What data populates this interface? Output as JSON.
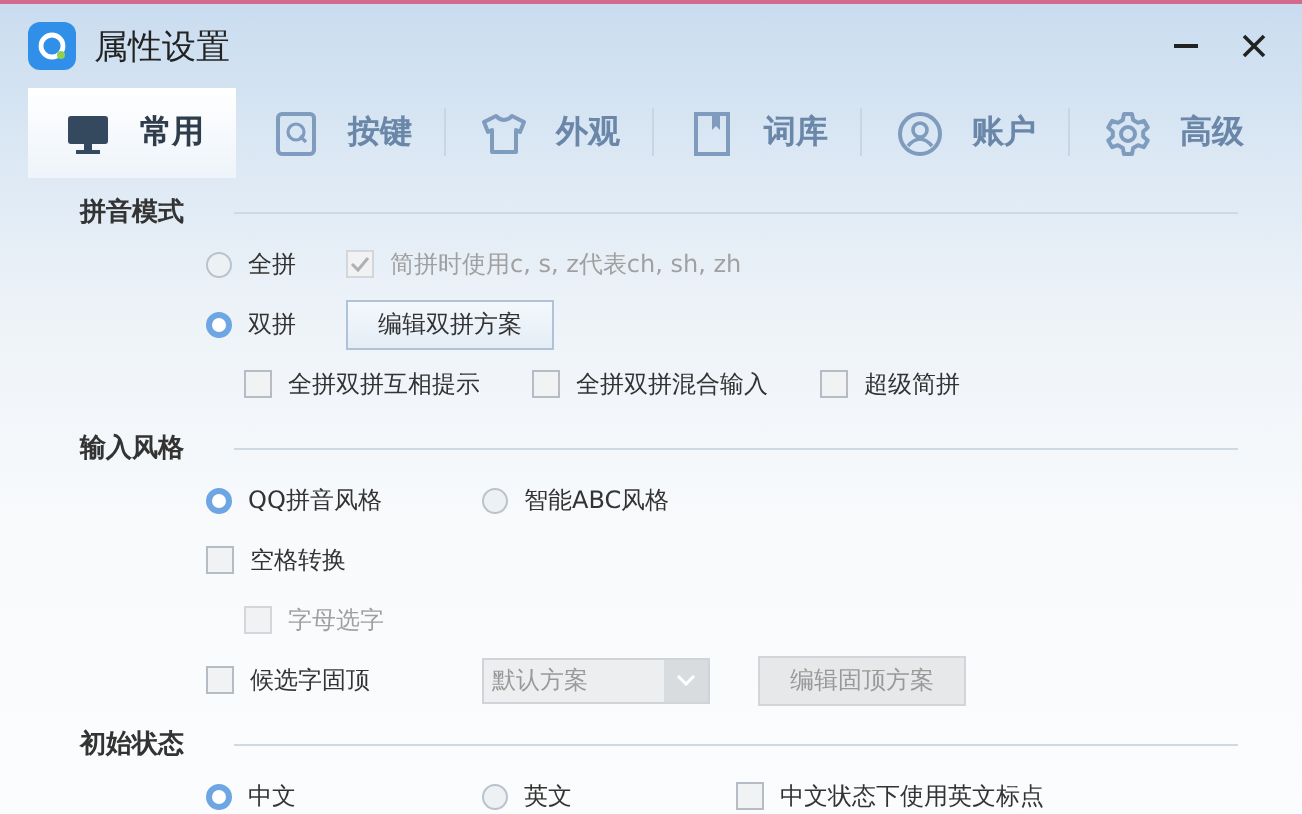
{
  "window": {
    "title": "属性设置"
  },
  "tabs": [
    {
      "label": "常用",
      "selected": true,
      "kind": "monitor"
    },
    {
      "label": "按键",
      "selected": false,
      "kind": "key"
    },
    {
      "label": "外观",
      "selected": false,
      "kind": "shirt"
    },
    {
      "label": "词库",
      "selected": false,
      "kind": "book"
    },
    {
      "label": "账户",
      "selected": false,
      "kind": "user"
    },
    {
      "label": "高级",
      "selected": false,
      "kind": "gear"
    }
  ],
  "sections": [
    {
      "title": "拼音模式",
      "rows": [
        [
          {
            "kind": "radio",
            "label": "全拼",
            "selected": false,
            "disabled": false
          },
          {
            "kind": "checkbox",
            "label": "简拼时使用c, s, z代表ch, sh, zh",
            "checked": true,
            "disabled": true
          }
        ],
        [
          {
            "kind": "radio",
            "label": "双拼",
            "selected": true,
            "disabled": false
          },
          {
            "kind": "button",
            "label": "编辑双拼方案",
            "disabled": false
          }
        ],
        [
          {
            "kind": "checkbox",
            "label": "全拼双拼互相提示",
            "checked": false,
            "disabled": false
          },
          {
            "kind": "checkbox",
            "label": "全拼双拼混合输入",
            "checked": false,
            "disabled": false
          },
          {
            "kind": "checkbox",
            "label": "超级简拼",
            "checked": false,
            "disabled": false
          }
        ]
      ]
    },
    {
      "title": "输入风格",
      "rows": [
        [
          {
            "kind": "radio",
            "label": "QQ拼音风格",
            "selected": true,
            "disabled": false
          },
          {
            "kind": "radio",
            "label": "智能ABC风格",
            "selected": false,
            "disabled": false
          }
        ],
        [
          {
            "kind": "checkbox",
            "label": "空格转换",
            "checked": false,
            "disabled": false
          }
        ],
        [
          {
            "kind": "checkbox",
            "label": "字母选字",
            "checked": false,
            "disabled": true
          }
        ],
        [
          {
            "kind": "checkbox",
            "label": "候选字固顶",
            "checked": false,
            "disabled": false
          },
          {
            "kind": "select",
            "value": "默认方案",
            "disabled": true
          },
          {
            "kind": "button",
            "label": "编辑固顶方案",
            "disabled": true
          }
        ]
      ]
    },
    {
      "title": "初始状态",
      "rows": [
        [
          {
            "kind": "radio",
            "label": "中文",
            "selected": true,
            "disabled": false
          },
          {
            "kind": "radio",
            "label": "英文",
            "selected": false,
            "disabled": false
          },
          {
            "kind": "checkbox",
            "label": "中文状态下使用英文标点",
            "checked": false,
            "disabled": false
          }
        ]
      ]
    }
  ]
}
